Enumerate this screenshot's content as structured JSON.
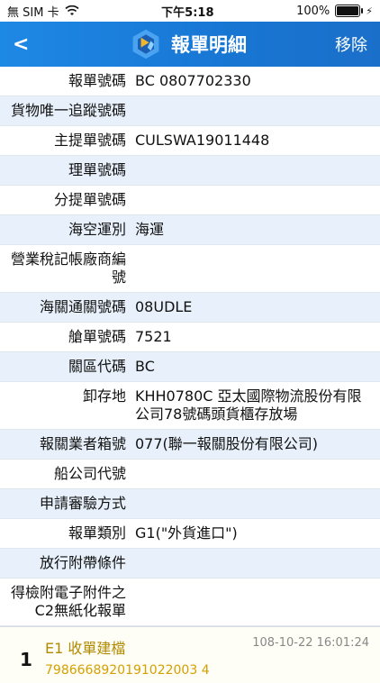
{
  "status_bar": {
    "carrier": "無 SIM 卡",
    "time": "下午5:18",
    "battery": "100%",
    "battery_level": 1.0
  },
  "nav": {
    "back": "<",
    "title": "報單明細",
    "remove": "移除"
  },
  "rows": [
    {
      "label": "報單號碼",
      "value": "BC  0807702330"
    },
    {
      "label": "貨物唯一追蹤號碼",
      "value": ""
    },
    {
      "label": "主提單號碼",
      "value": "CULSWA19011448"
    },
    {
      "label": "理單號碼",
      "value": ""
    },
    {
      "label": "分提單號碼",
      "value": ""
    },
    {
      "label": "海空運別",
      "value": "海運"
    },
    {
      "label": "營業稅記帳廠商編號",
      "value": ""
    },
    {
      "label": "海關通關號碼",
      "value": "08UDLE"
    },
    {
      "label": "艙單號碼",
      "value": "7521"
    },
    {
      "label": "關區代碼",
      "value": "BC"
    },
    {
      "label": "卸存地",
      "value": "KHH0780C 亞太國際物流股份有限公司78號碼頭貨櫃存放場"
    },
    {
      "label": "報關業者箱號",
      "value": "077(聯一報關股份有限公司)"
    },
    {
      "label": "船公司代號",
      "value": ""
    },
    {
      "label": "申請審驗方式",
      "value": ""
    },
    {
      "label": "報單類別",
      "value": "G1(\"外貨進口\")"
    },
    {
      "label": "放行附帶條件",
      "value": ""
    },
    {
      "label": "得檢附電子附件之C2無紙化報單",
      "value": ""
    }
  ],
  "event": {
    "index": "1",
    "name": "E1 收單建檔",
    "timestamp": "108-10-22 16:01:24",
    "code": "7986668920191022003 4"
  }
}
